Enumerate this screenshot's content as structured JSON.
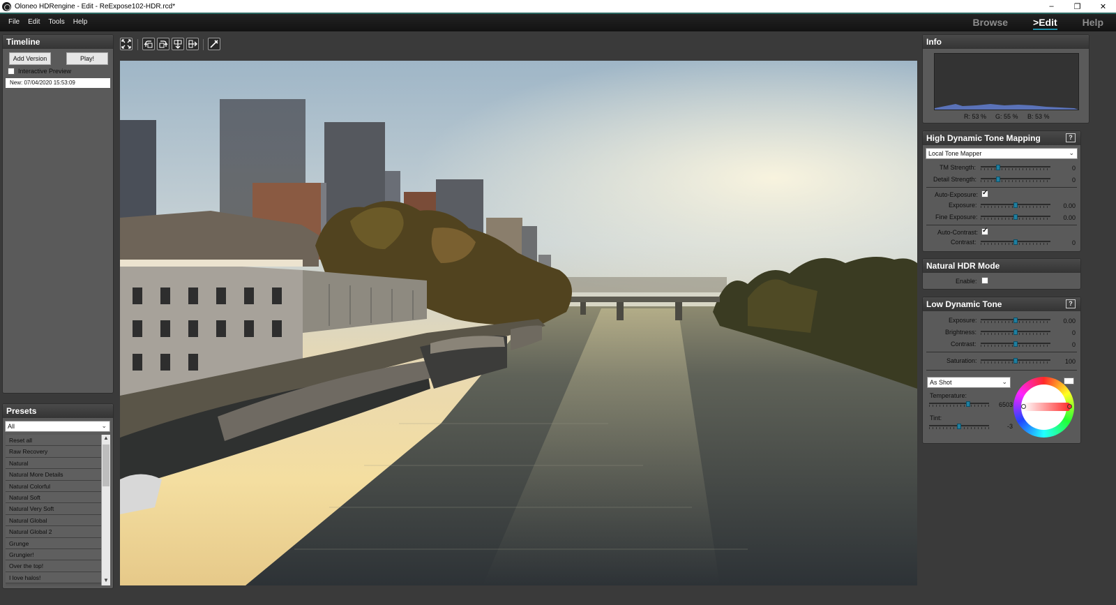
{
  "titlebar": {
    "title": "Oloneo HDRengine - Edit - ReExpose102-HDR.rcd*",
    "min": "–",
    "restore": "❐",
    "close": "✕"
  },
  "menu": [
    "File",
    "Edit",
    "Tools",
    "Help"
  ],
  "mode_tabs": [
    "Browse",
    ">Edit",
    "Help"
  ],
  "timeline": {
    "title": "Timeline",
    "add_version": "Add Version",
    "play": "Play!",
    "interactive_preview": "Interactive Preview",
    "versions": [
      "New: 07/04/2020 15:53:09"
    ]
  },
  "presets": {
    "title": "Presets",
    "filter": "All",
    "items": [
      "Reset all",
      "Raw Recovery",
      "Natural",
      "Natural More Details",
      "Natural Colorful",
      "Natural Soft",
      "Natural Very Soft",
      "Natural Global",
      "Natural Global 2",
      "Grunge",
      "Grungier!",
      "Over the top!",
      "I love halos!"
    ]
  },
  "info": {
    "title": "Info",
    "r": "R: 53 %",
    "g": "G: 55 %",
    "b": "B: 53 %"
  },
  "hdtm": {
    "title": "High Dynamic Tone Mapping",
    "help": "?",
    "mode": "Local Tone Mapper",
    "tm_strength_label": "TM Strength:",
    "tm_strength_value": "0",
    "detail_strength_label": "Detail Strength:",
    "detail_strength_value": "0",
    "auto_exposure_label": "Auto-Exposure:",
    "exposure_label": "Exposure:",
    "exposure_value": "0.00",
    "fine_exposure_label": "Fine Exposure:",
    "fine_exposure_value": "0.00",
    "auto_contrast_label": "Auto-Contrast:",
    "contrast_label": "Contrast:",
    "contrast_value": "0"
  },
  "natural_hdr": {
    "title": "Natural HDR Mode",
    "enable_label": "Enable:"
  },
  "ldt": {
    "title": "Low Dynamic Tone",
    "help": "?",
    "exposure_label": "Exposure:",
    "exposure_value": "0.00",
    "brightness_label": "Brightness:",
    "brightness_value": "0",
    "contrast_label": "Contrast:",
    "contrast_value": "0",
    "saturation_label": "Saturation:",
    "saturation_value": "100",
    "wb_mode": "As Shot",
    "temperature_label": "Temperature:",
    "temperature_value": "6503",
    "tint_label": "Tint:",
    "tint_value": "-3"
  },
  "toolbar_icons": [
    "fit-to-window-icon",
    "rotate-left-icon",
    "rotate-right-icon",
    "flip-vertical-icon",
    "flip-horizontal-icon",
    "color-picker-icon"
  ],
  "colors": {
    "accent": "#1f8fa8",
    "panel_bg": "#5a5a5a",
    "app_bg": "#3a3a3a"
  }
}
